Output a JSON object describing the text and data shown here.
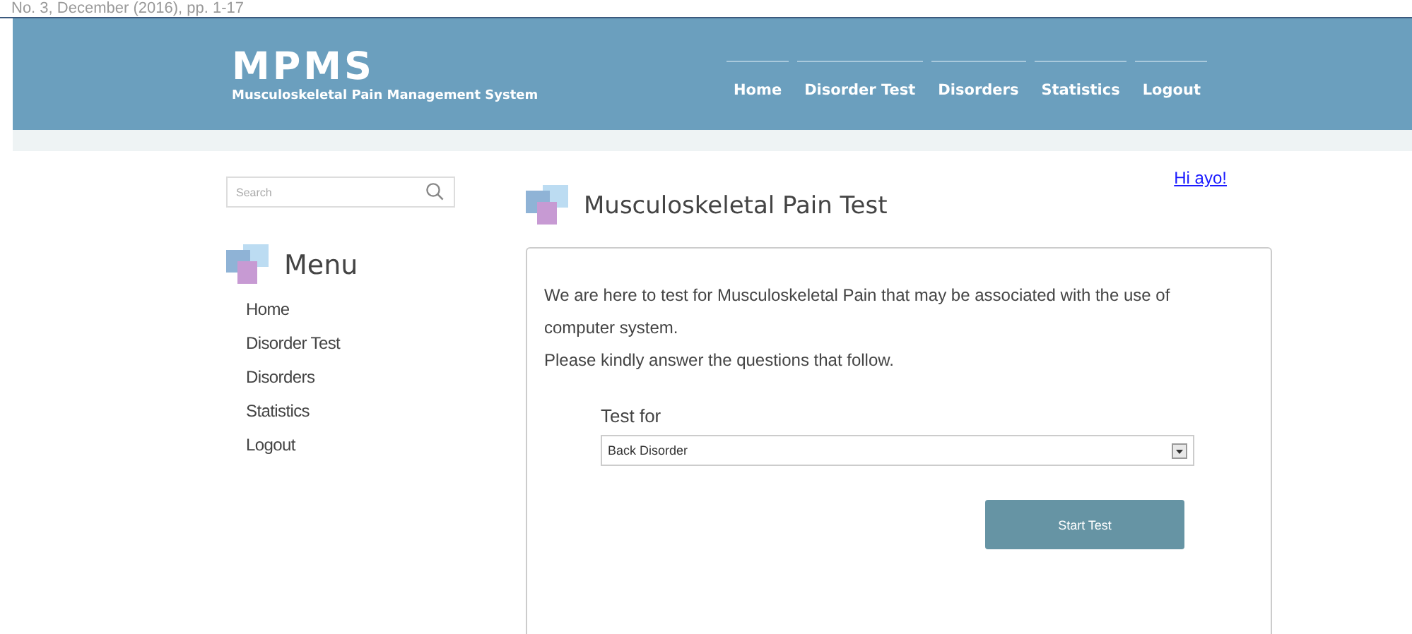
{
  "page_header": {
    "text": "No. 3, December (2016), pp. 1-17"
  },
  "site": {
    "logo": "MPMS",
    "tagline": "Musculoskeletal Pain Management System"
  },
  "nav": [
    "Home",
    "Disorder Test",
    "Disorders",
    "Statistics",
    "Logout"
  ],
  "search": {
    "placeholder": "Search"
  },
  "menu": {
    "title": "Menu",
    "items": [
      "Home",
      "Disorder Test",
      "Disorders",
      "Statistics",
      "Logout"
    ]
  },
  "main": {
    "title": "Musculoskeletal Pain Test",
    "user_link": "Hi  ayo!",
    "intro": [
      "We are here to test for Musculoskeletal Pain that may be associated with the use of computer system.",
      "Please kindly answer the questions that follow."
    ],
    "field_label": "Test for",
    "select_value": "Back Disorder",
    "button": "Start Test"
  }
}
